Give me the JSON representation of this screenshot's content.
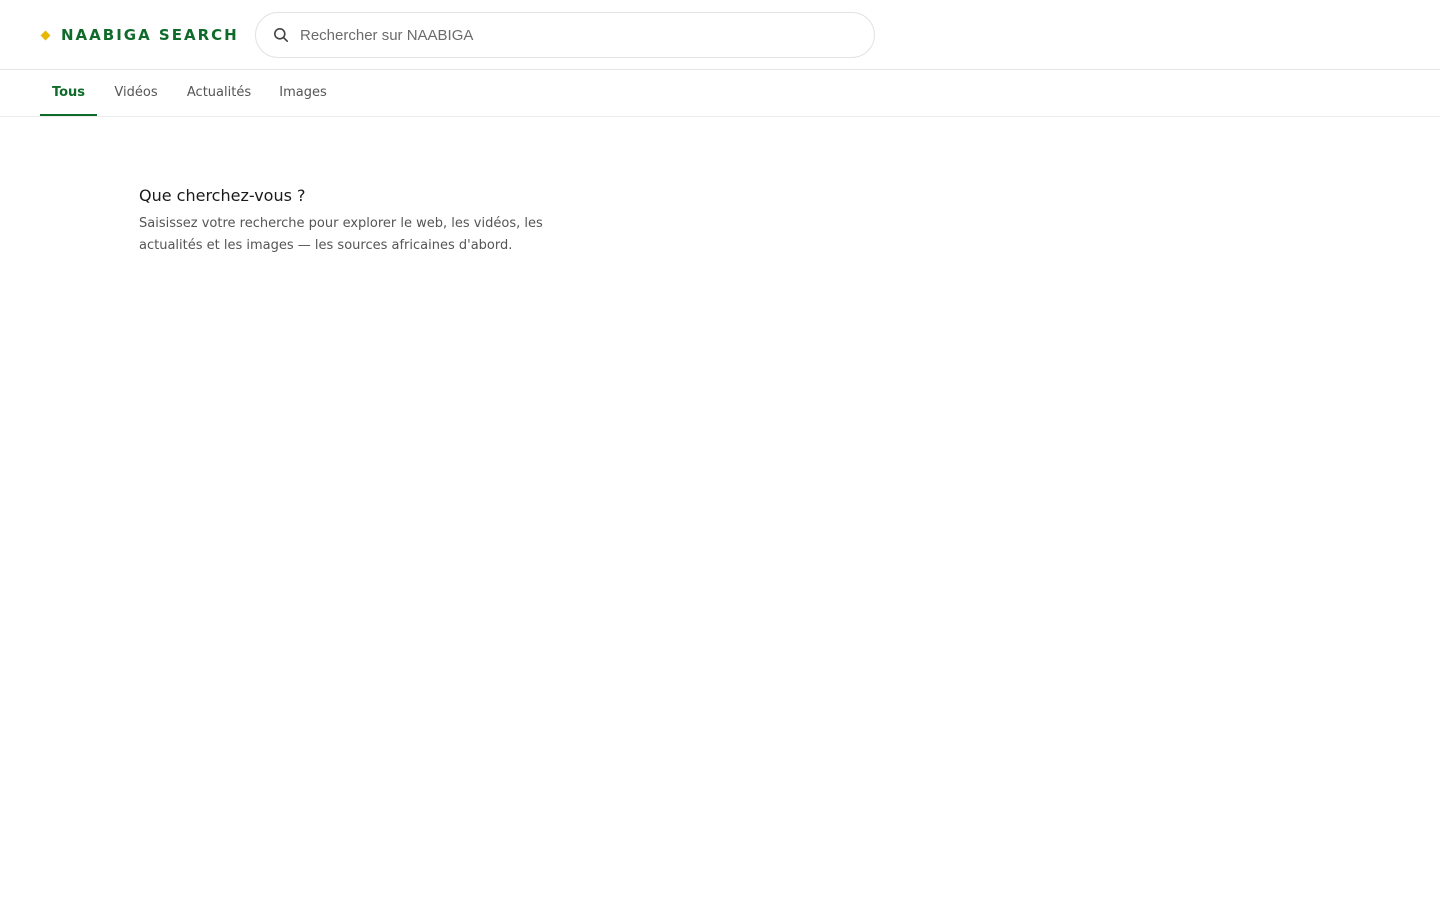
{
  "header": {
    "logo_text": "NAABIGA SEARCH",
    "search": {
      "placeholder": "Rechercher sur NAABIGA",
      "value": "",
      "icon": "search-icon"
    }
  },
  "tabs": [
    {
      "label": "Tous",
      "active": true
    },
    {
      "label": "Vidéos",
      "active": false
    },
    {
      "label": "Actualités",
      "active": false
    },
    {
      "label": "Images",
      "active": false
    }
  ],
  "empty_state": {
    "title": "Que cherchez-vous ?",
    "description": "Saisissez votre recherche pour explorer le web, les vidéos, les actualités et les images — les sources africaines d'abord."
  },
  "colors": {
    "brand": "#0f6b2a",
    "accent": "#e6b800",
    "muted_text": "#555555"
  }
}
